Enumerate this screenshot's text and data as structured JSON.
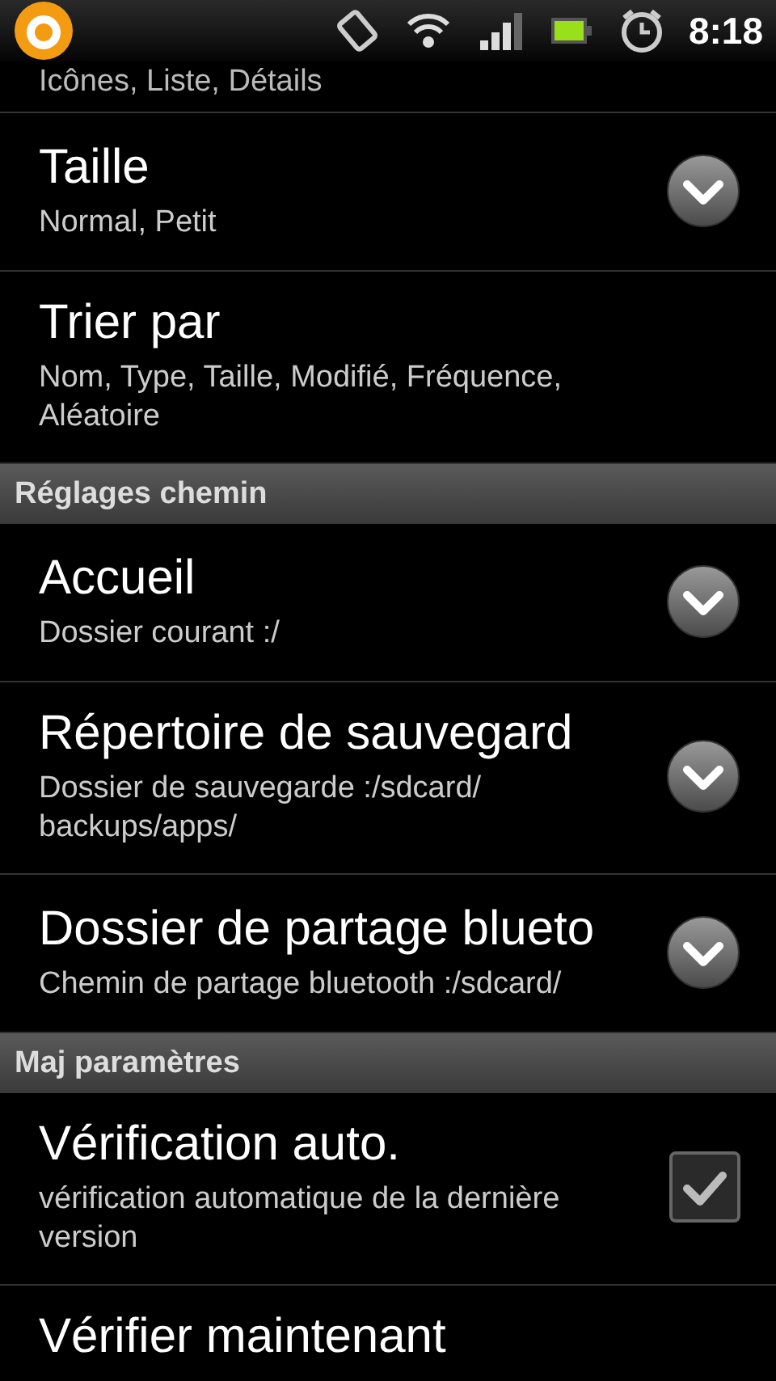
{
  "status_bar": {
    "time": "8:18"
  },
  "partial_top": {
    "summary": "Icônes, Liste, Détails"
  },
  "sections": [
    {
      "items": [
        {
          "kind": "dropdown",
          "title": "Taille",
          "summary": "Normal, Petit"
        },
        {
          "kind": "none",
          "title": "Trier par",
          "summary": "Nom, Type, Taille, Modifié, Fréquence, Aléatoire"
        }
      ]
    },
    {
      "header": "Réglages chemin",
      "items": [
        {
          "kind": "dropdown",
          "title": "Accueil",
          "summary": "Dossier courant :/"
        },
        {
          "kind": "dropdown",
          "title": "Répertoire de sauvegard",
          "summary": "Dossier de sauvegarde :/sdcard/ backups/apps/"
        },
        {
          "kind": "dropdown",
          "title": "Dossier de partage blueto",
          "summary": "Chemin de partage bluetooth :/sdcard/"
        }
      ]
    },
    {
      "header": "Maj paramètres",
      "items": [
        {
          "kind": "checkbox",
          "title": "Vérification auto.",
          "summary": "vérification automatique de la dernière version",
          "checked": true
        },
        {
          "kind": "none",
          "title": "Vérifier maintenant"
        }
      ]
    }
  ]
}
